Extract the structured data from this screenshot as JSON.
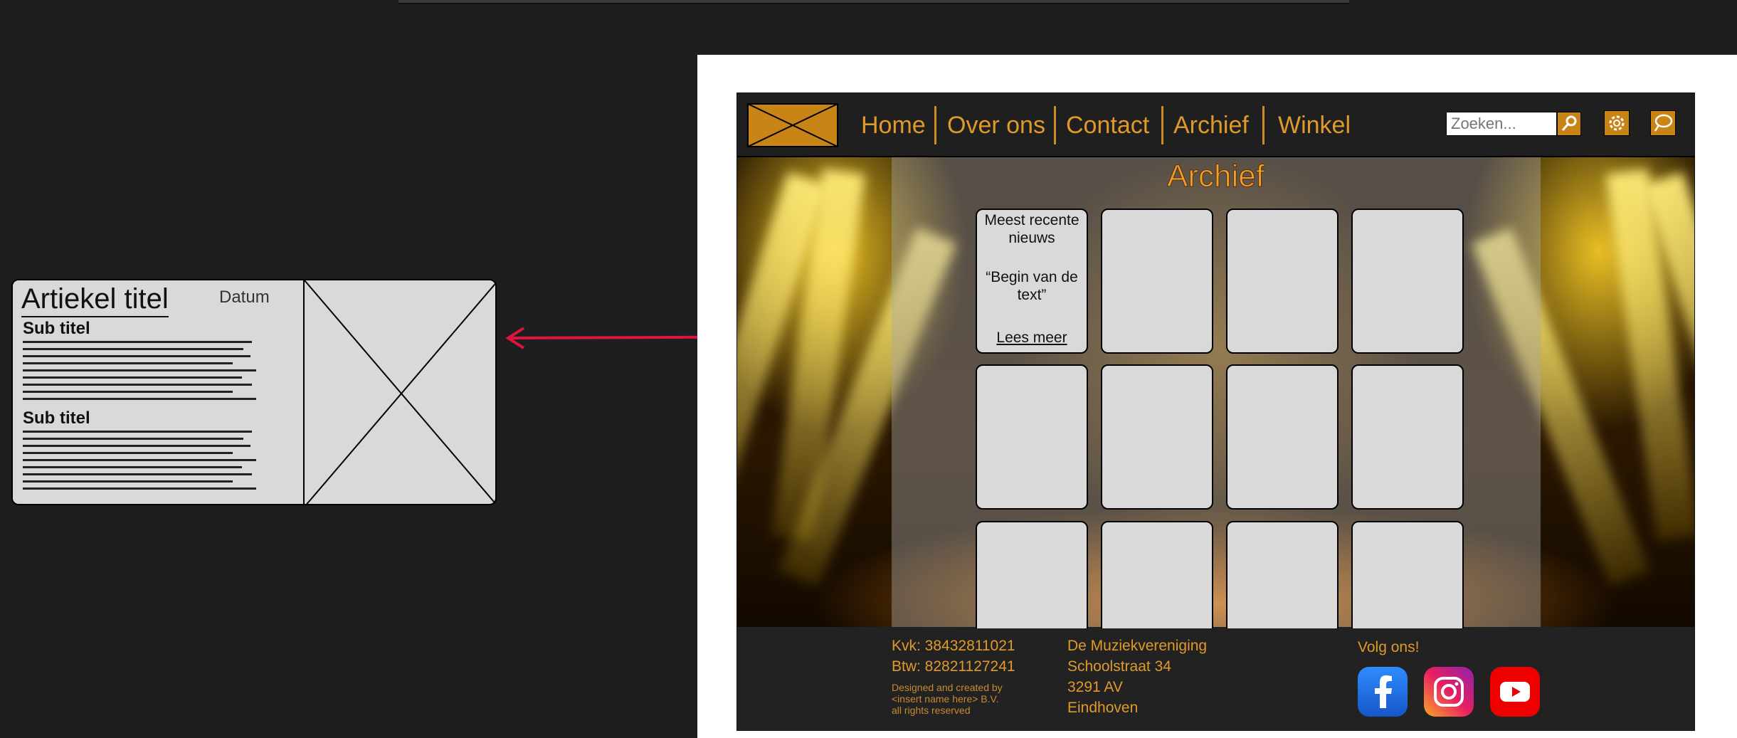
{
  "card": {
    "title": "Artiekel titel",
    "date": "Datum",
    "subtitle1": "Sub titel",
    "subtitle2": "Sub titel"
  },
  "nav": {
    "items": [
      "Home",
      "Over ons",
      "Contact",
      "Archief",
      "Winkel"
    ],
    "search_placeholder": "Zoeken..."
  },
  "main": {
    "title": "Archief",
    "featured": {
      "heading": "Meest recente nieuws",
      "excerpt": "“Begin van de text”",
      "link": "Lees meer"
    }
  },
  "footer": {
    "kvk": "Kvk: 38432811021",
    "btw": "Btw: 82821127241",
    "credits1": "Designed and created by",
    "credits2": "<insert name here> B.V.",
    "credits3": "all rights reserved",
    "org": "De Muziekvereniging",
    "street": "Schoolstraat 34",
    "postal": "3291 AV",
    "city": "Eindhoven",
    "follow": "Volg ons!"
  },
  "colors": {
    "accent": "#e09a2a",
    "arrow": "#e0143c",
    "tile": "#d9d9d9"
  },
  "icons": [
    "logo-placeholder-icon",
    "search-icon",
    "gear-icon",
    "chat-icon",
    "facebook-icon",
    "instagram-icon",
    "youtube-icon"
  ]
}
